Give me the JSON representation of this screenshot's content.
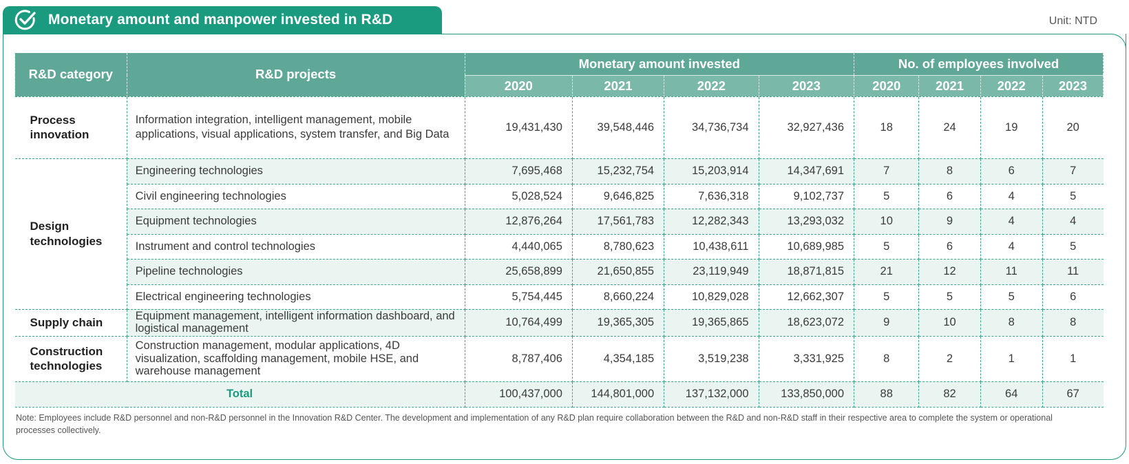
{
  "header": {
    "title": "Monetary amount and manpower invested in R&D",
    "unit": "Unit: NTD"
  },
  "table": {
    "col_category": "R&D category",
    "col_projects": "R&D projects",
    "group_money": "Monetary amount invested",
    "group_employees": "No. of employees involved",
    "years": [
      "2020",
      "2021",
      "2022",
      "2023"
    ],
    "rows": [
      {
        "category": "Process innovation",
        "project": "Information integration, intelligent management, mobile applications, visual applications, system transfer, and Big Data",
        "money": [
          "19,431,430",
          "39,548,446",
          "34,736,734",
          "32,927,436"
        ],
        "employees": [
          "18",
          "24",
          "19",
          "20"
        ]
      },
      {
        "category": "Design technologies",
        "project": "Engineering technologies",
        "money": [
          "7,695,468",
          "15,232,754",
          "15,203,914",
          "14,347,691"
        ],
        "employees": [
          "7",
          "8",
          "6",
          "7"
        ]
      },
      {
        "category": "",
        "project": "Civil engineering technologies",
        "money": [
          "5,028,524",
          "9,646,825",
          "7,636,318",
          "9,102,737"
        ],
        "employees": [
          "5",
          "6",
          "4",
          "5"
        ]
      },
      {
        "category": "",
        "project": "Equipment technologies",
        "money": [
          "12,876,264",
          "17,561,783",
          "12,282,343",
          "13,293,032"
        ],
        "employees": [
          "10",
          "9",
          "4",
          "4"
        ]
      },
      {
        "category": "",
        "project": "Instrument and control technologies",
        "money": [
          "4,440,065",
          "8,780,623",
          "10,438,611",
          "10,689,985"
        ],
        "employees": [
          "5",
          "6",
          "4",
          "5"
        ]
      },
      {
        "category": "",
        "project": "Pipeline technologies",
        "money": [
          "25,658,899",
          "21,650,855",
          "23,119,949",
          "18,871,815"
        ],
        "employees": [
          "21",
          "12",
          "11",
          "11"
        ]
      },
      {
        "category": "",
        "project": "Electrical engineering technologies",
        "money": [
          "5,754,445",
          "8,660,224",
          "10,829,028",
          "12,662,307"
        ],
        "employees": [
          "5",
          "5",
          "5",
          "6"
        ]
      },
      {
        "category": "Supply chain",
        "project": "Equipment management, intelligent information dashboard, and logistical management",
        "money": [
          "10,764,499",
          "19,365,305",
          "19,365,865",
          "18,623,072"
        ],
        "employees": [
          "9",
          "10",
          "8",
          "8"
        ]
      },
      {
        "category": "Construction technologies",
        "project": "Construction management, modular applications, 4D visualization, scaffolding management, mobile HSE, and warehouse management",
        "money": [
          "8,787,406",
          "4,354,185",
          "3,519,238",
          "3,331,925"
        ],
        "employees": [
          "8",
          "2",
          "1",
          "1"
        ]
      }
    ],
    "total": {
      "label": "Total",
      "money": [
        "100,437,000",
        "144,801,000",
        "137,132,000",
        "133,850,000"
      ],
      "employees": [
        "88",
        "82",
        "64",
        "67"
      ]
    }
  },
  "note": "Note: Employees include R&D personnel and non-R&D personnel in the Innovation R&D Center. The development and implementation of any R&D plan require collaboration between the R&D and non-R&D staff in their respective area to complete the system or operational processes collectively.",
  "colors": {
    "accent": "#1a9b7f",
    "header_bg": "#5fa898",
    "stripe": "#eaf5f1"
  },
  "icons": {
    "title_icon": "check-circle-icon"
  }
}
